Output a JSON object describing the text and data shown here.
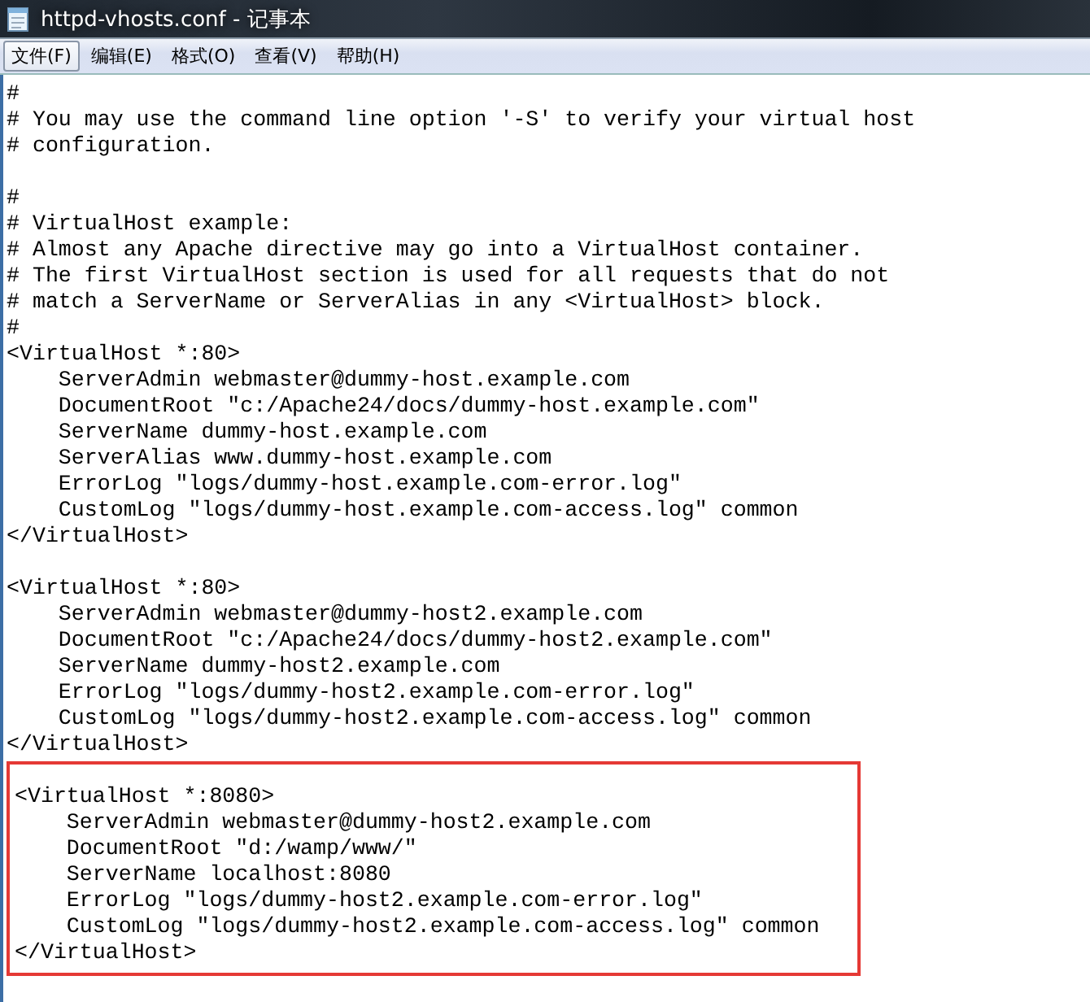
{
  "window": {
    "title": "httpd-vhosts.conf - 记事本"
  },
  "menu": [
    {
      "label": "文件(F)",
      "selected": true
    },
    {
      "label": "编辑(E)",
      "selected": false
    },
    {
      "label": "格式(O)",
      "selected": false
    },
    {
      "label": "查看(V)",
      "selected": false
    },
    {
      "label": "帮助(H)",
      "selected": false
    }
  ],
  "editor": {
    "sections": [
      {
        "highlighted": false,
        "lines": [
          "#",
          "# You may use the command line option '-S' to verify your virtual host",
          "# configuration."
        ]
      },
      {
        "highlighted": false,
        "lines": [
          "#",
          "# VirtualHost example:",
          "# Almost any Apache directive may go into a VirtualHost container.",
          "# The first VirtualHost section is used for all requests that do not",
          "# match a ServerName or ServerAlias in any <VirtualHost> block.",
          "#",
          "<VirtualHost *:80>",
          "    ServerAdmin webmaster@dummy-host.example.com",
          "    DocumentRoot \"c:/Apache24/docs/dummy-host.example.com\"",
          "    ServerName dummy-host.example.com",
          "    ServerAlias www.dummy-host.example.com",
          "    ErrorLog \"logs/dummy-host.example.com-error.log\"",
          "    CustomLog \"logs/dummy-host.example.com-access.log\" common",
          "</VirtualHost>"
        ]
      },
      {
        "highlighted": false,
        "lines": [
          "<VirtualHost *:80>",
          "    ServerAdmin webmaster@dummy-host2.example.com",
          "    DocumentRoot \"c:/Apache24/docs/dummy-host2.example.com\"",
          "    ServerName dummy-host2.example.com",
          "    ErrorLog \"logs/dummy-host2.example.com-error.log\"",
          "    CustomLog \"logs/dummy-host2.example.com-access.log\" common",
          "</VirtualHost>"
        ]
      },
      {
        "highlighted": true,
        "lines": [
          "<VirtualHost *:8080>",
          "    ServerAdmin webmaster@dummy-host2.example.com",
          "    DocumentRoot \"d:/wamp/www/\"",
          "    ServerName localhost:8080",
          "    ErrorLog \"logs/dummy-host2.example.com-error.log\"",
          "    CustomLog \"logs/dummy-host2.example.com-access.log\" common",
          "</VirtualHost>"
        ]
      }
    ]
  }
}
